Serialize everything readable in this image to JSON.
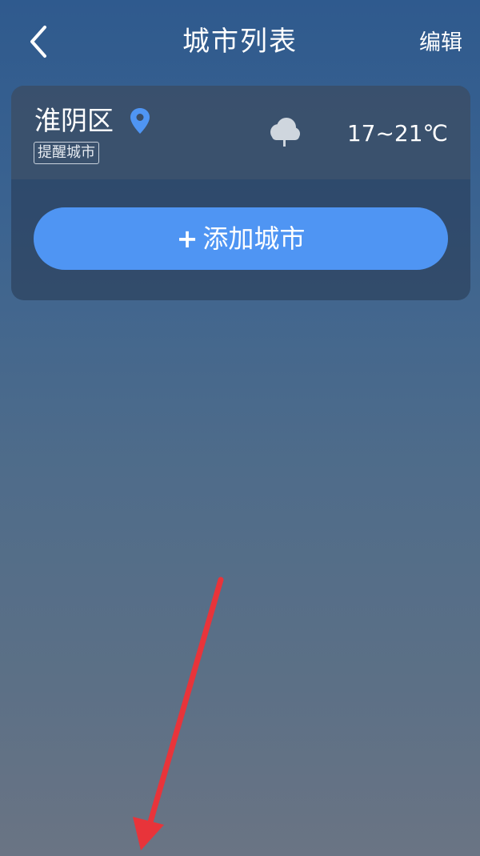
{
  "header": {
    "back_icon": "chevron-left-icon",
    "title": "城市列表",
    "edit_label": "编辑"
  },
  "city_list": {
    "items": [
      {
        "name": "淮阴区",
        "location_icon": "location-pin-icon",
        "badge": "提醒城市",
        "weather_icon": "cloudy-icon",
        "temperature": "17~21℃"
      }
    ],
    "add_button": {
      "plus": "+",
      "label": "添加城市"
    }
  },
  "annotation": {
    "arrow_color": "#e8343a",
    "icon": "red-arrow-annotation"
  },
  "colors": {
    "accent": "#4f95f3",
    "location_pin": "#4f95f3"
  }
}
